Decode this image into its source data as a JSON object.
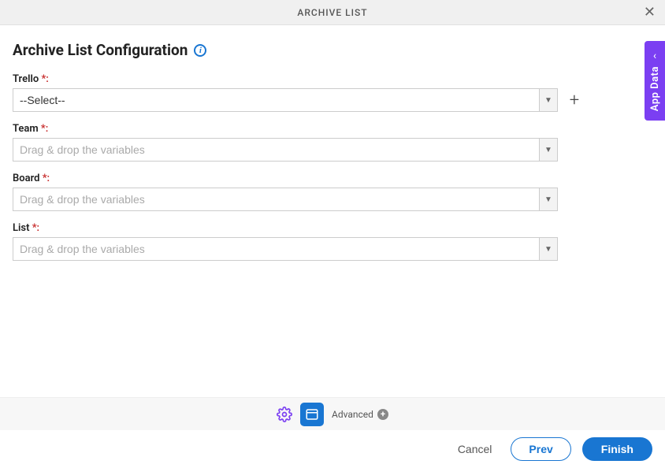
{
  "header": {
    "title": "ARCHIVE LIST"
  },
  "page": {
    "title": "Archive List Configuration"
  },
  "fields": {
    "trello": {
      "label": "Trello",
      "required_colon": " *:",
      "value": "--Select--"
    },
    "team": {
      "label": "Team",
      "required_colon": " *:",
      "placeholder": "Drag & drop the variables"
    },
    "board": {
      "label": "Board",
      "required_colon": " *:",
      "placeholder": "Drag & drop the variables"
    },
    "list": {
      "label": "List",
      "required_colon": " *:",
      "placeholder": "Drag & drop the variables"
    }
  },
  "side_tab": {
    "label": "App Data"
  },
  "toolbar": {
    "advanced_label": "Advanced"
  },
  "footer": {
    "cancel": "Cancel",
    "prev": "Prev",
    "finish": "Finish"
  }
}
